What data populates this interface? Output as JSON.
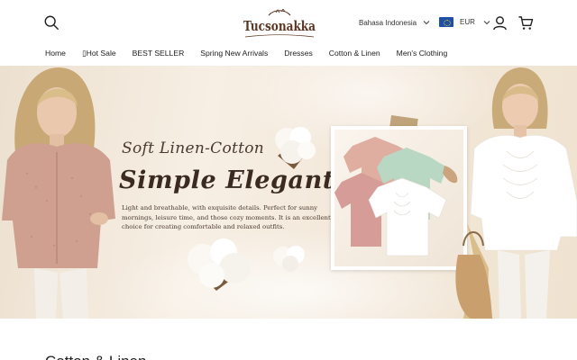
{
  "header": {
    "logo_text": "Tucsonakka",
    "language": "Bahasa Indonesia",
    "currency": "EUR",
    "icons": {
      "search": "search-icon",
      "language_chevron": "chevron-down-icon",
      "flag": "eu-flag-icon",
      "currency_chevron": "chevron-down-icon",
      "account": "user-icon",
      "cart": "cart-icon"
    }
  },
  "nav": {
    "items": [
      {
        "label": "Home"
      },
      {
        "label": "Hot Sale"
      },
      {
        "label": "BEST SELLER"
      },
      {
        "label": "Spring New Arrivals"
      },
      {
        "label": "Dresses"
      },
      {
        "label": "Cotton & Linen"
      },
      {
        "label": "Men's Clothing"
      }
    ]
  },
  "banner": {
    "subtitle": "Soft Linen-Cotton",
    "title": "Simple  Elegant",
    "description": "Light and breathable, with exquisite details. Perfect for sunny mornings, leisure time, and those cozy moments. It is an excellent choice for creating comfortable and relaxed outfits."
  },
  "section": {
    "heading": "Cotton & Linen"
  },
  "colors": {
    "banner_bg": "#f3e8da",
    "text_dark": "#3a2a20",
    "logo_brown": "#5a3521",
    "shirt_pink": "#d8a79a",
    "shirt_mint": "#b9d8c4",
    "shirt_white": "#ffffff"
  }
}
